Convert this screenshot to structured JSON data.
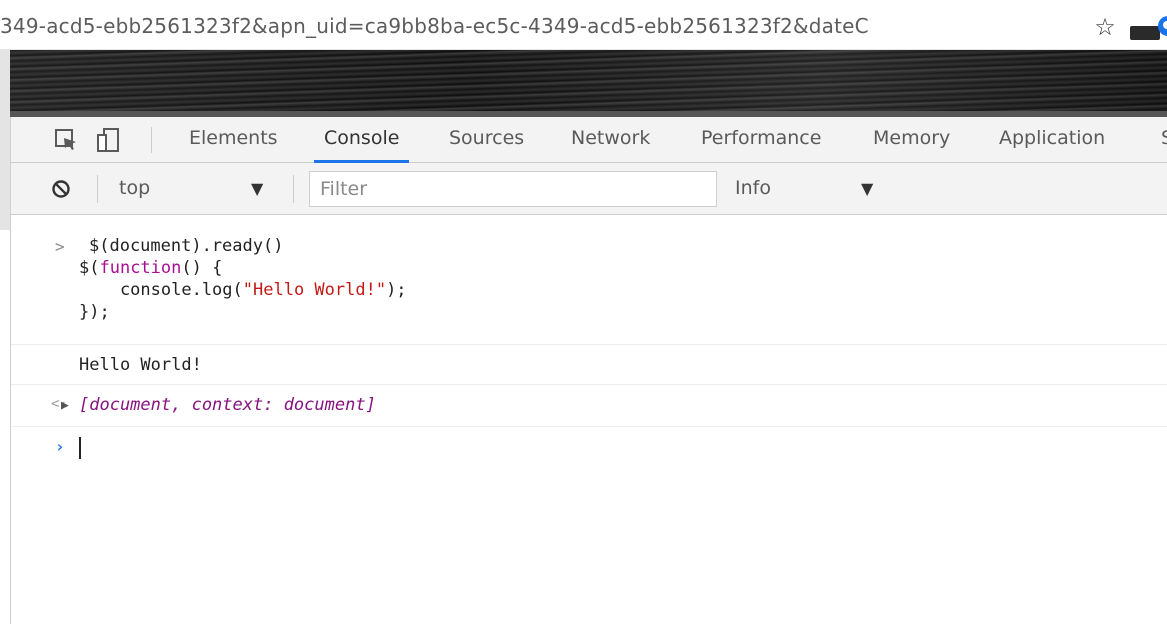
{
  "browser": {
    "url_text": "349-acd5-ebb2561323f2&apn_uid=ca9bb8ba-ec5c-4349-acd5-ebb2561323f2&dateC"
  },
  "devtools": {
    "tabs": [
      {
        "label": "Elements"
      },
      {
        "label": "Console"
      },
      {
        "label": "Sources"
      },
      {
        "label": "Network"
      },
      {
        "label": "Performance"
      },
      {
        "label": "Memory"
      },
      {
        "label": "Application"
      },
      {
        "label": "S"
      }
    ],
    "active_tab": "Console",
    "filterbar": {
      "context": "top",
      "filter_placeholder": "Filter",
      "filter_value": "",
      "level": "Info"
    }
  },
  "console": {
    "input": {
      "line1": "$(document).ready()",
      "line2_prefix": "$(",
      "line2_keyword": "function",
      "line2_suffix": "() {",
      "line3_prefix": "    console.log(",
      "line3_string": "\"Hello World!\"",
      "line3_suffix": ");",
      "line4": "});"
    },
    "log_output": "Hello World!",
    "return_value": "[document, context: document]"
  },
  "colors": {
    "accent": "#1a73e8",
    "keyword": "#aa0d91",
    "string": "#c41a16",
    "return_value": "#881280"
  },
  "icons": {
    "inspect": "inspect-element-icon",
    "device": "device-toolbar-icon",
    "clear": "clear-console-icon",
    "star": "bookmark-star-icon",
    "profile": "profile-icon"
  }
}
